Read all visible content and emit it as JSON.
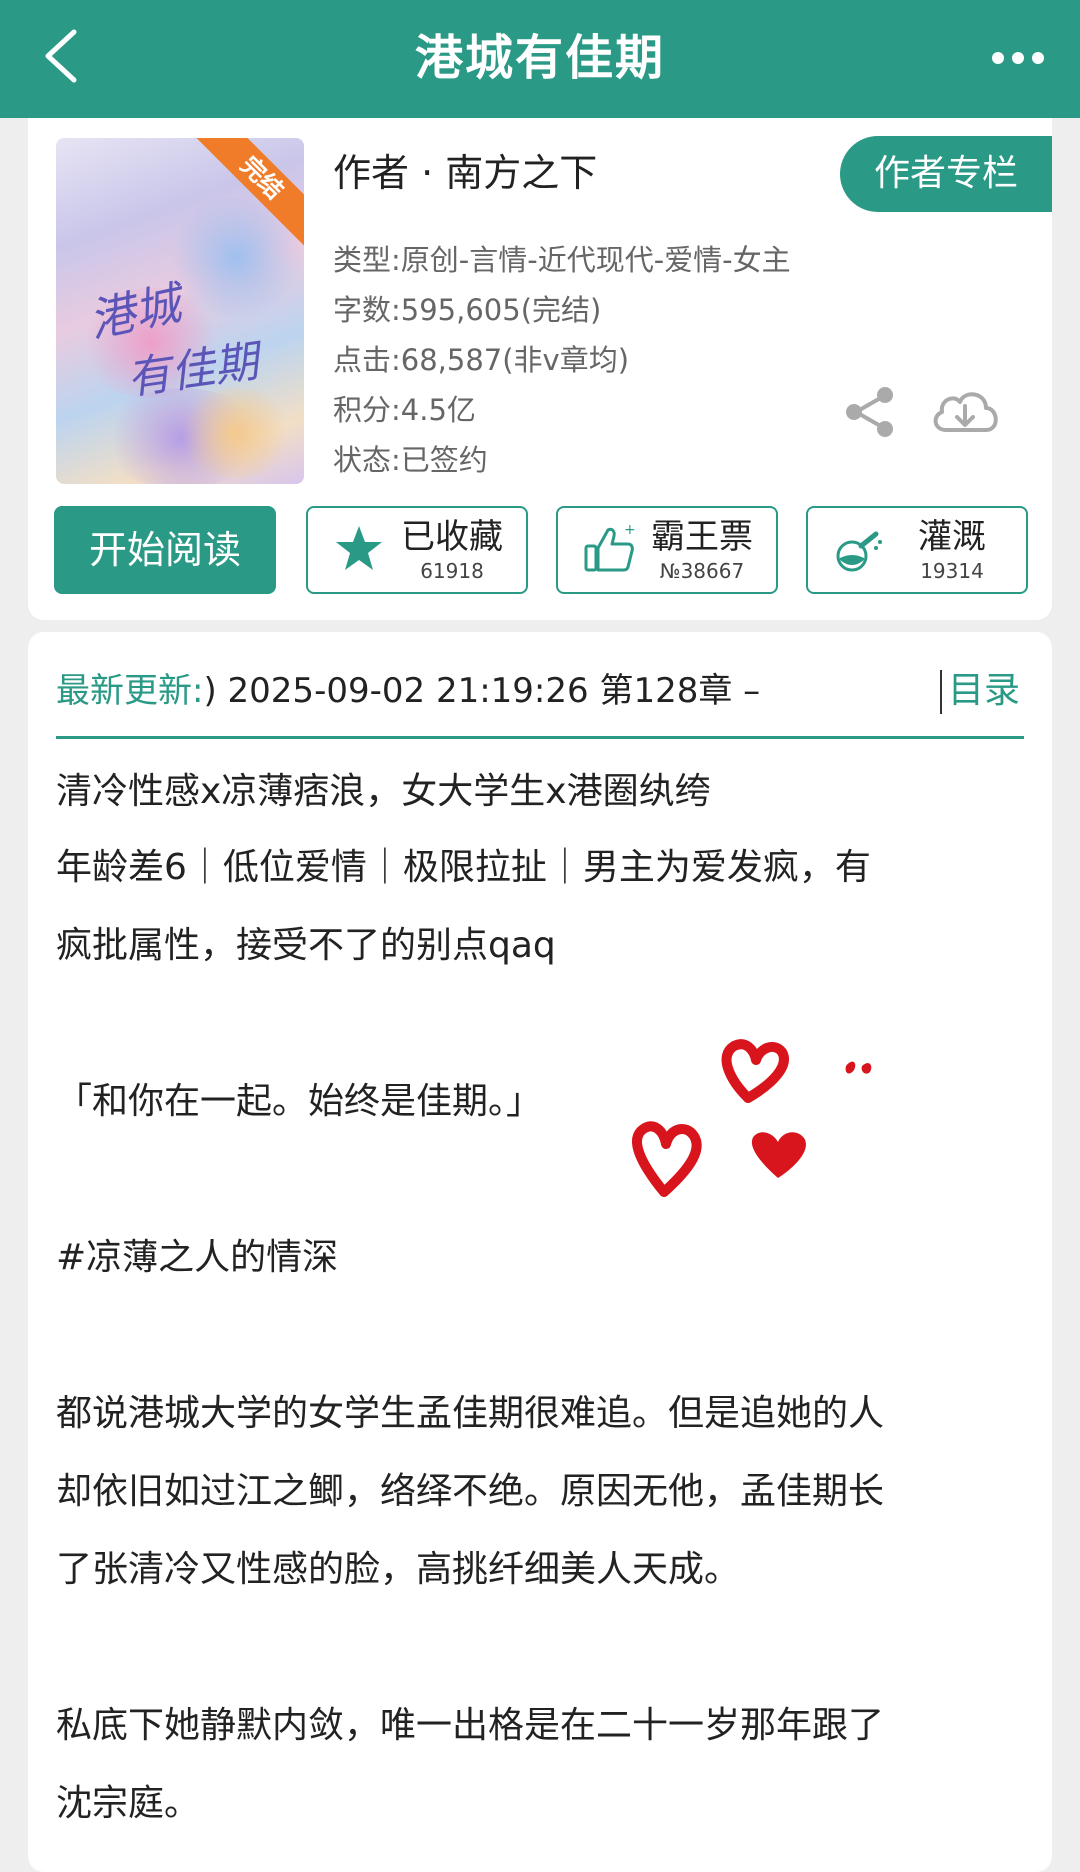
{
  "header": {
    "title": "港城有佳期",
    "back_icon": "back-arrow-icon",
    "more_icon": "more-dots-icon"
  },
  "book": {
    "cover_title_line1": "港城",
    "cover_title_line2": "有佳期",
    "status_ribbon": "完结",
    "author": "作者 · 南方之下",
    "author_column_button": "作者专栏",
    "type": "类型:原创-言情-近代现代-爱情-女主",
    "word_count": "字数:595,605(完结)",
    "clicks": "点击:68,587(非v章均)",
    "score": "积分:4.5亿",
    "status": "状态:已签约"
  },
  "actions": {
    "read_button": "开始阅读",
    "favorite": {
      "label": "已收藏",
      "count": "61918",
      "icon": "star-icon"
    },
    "ticket": {
      "label": "霸王票",
      "count": "№38667",
      "icon": "thumbs-up-icon"
    },
    "water": {
      "label": "灌溉",
      "count": "19314",
      "icon": "watering-flask-icon"
    }
  },
  "update": {
    "label": "最新更新:",
    "value": ") 2025-09-02 21:19:26   第128章 –",
    "toc": "目录"
  },
  "description": {
    "lines": [
      "清冷性感x凉薄痞浪，女大学生x港圈纨绔",
      "年龄差6｜低位爱情｜极限拉扯｜男主为爱发疯，有",
      "疯批属性，接受不了的别点qaq",
      "「和你在一起。始终是佳期。」",
      "#凉薄之人的情深",
      "都说港城大学的女学生孟佳期很难追。但是追她的人",
      "却依旧如过江之鲫，络绎不绝。原因无他，孟佳期长",
      "了张清冷又性感的脸，高挑纤细美人天成。",
      "私底下她静默内敛，唯一出格是在二十一岁那年跟了",
      "沈宗庭。"
    ]
  },
  "colors": {
    "accent": "#2a9a86",
    "ribbon": "#f07c2a",
    "heart": "#d8141c"
  }
}
